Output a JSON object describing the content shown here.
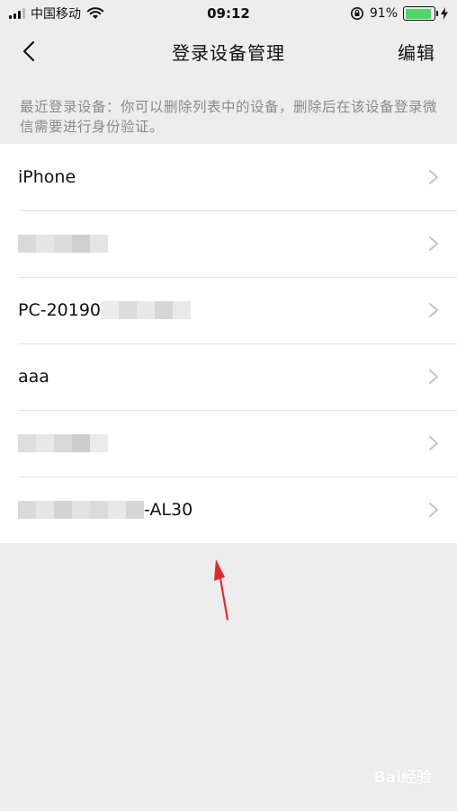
{
  "status_bar": {
    "carrier": "中国移动",
    "time": "09:12",
    "battery": "91%",
    "battery_level": 0.91
  },
  "nav": {
    "title": "登录设备管理",
    "edit_label": "编辑"
  },
  "description": "最近登录设备：你可以删除列表中的设备，删除后在该设备登录微信需要进行身份验证。",
  "devices": [
    {
      "label": "iPhone"
    },
    {
      "label": ""
    },
    {
      "label": "PC-20190"
    },
    {
      "label": "aaa"
    },
    {
      "label": ""
    },
    {
      "label": "-AL30"
    }
  ],
  "watermark": "Bai经验",
  "colors": {
    "background": "#ededed",
    "row_bg": "#ffffff",
    "arrow": "#e8262a",
    "battery": "#4cd964"
  }
}
